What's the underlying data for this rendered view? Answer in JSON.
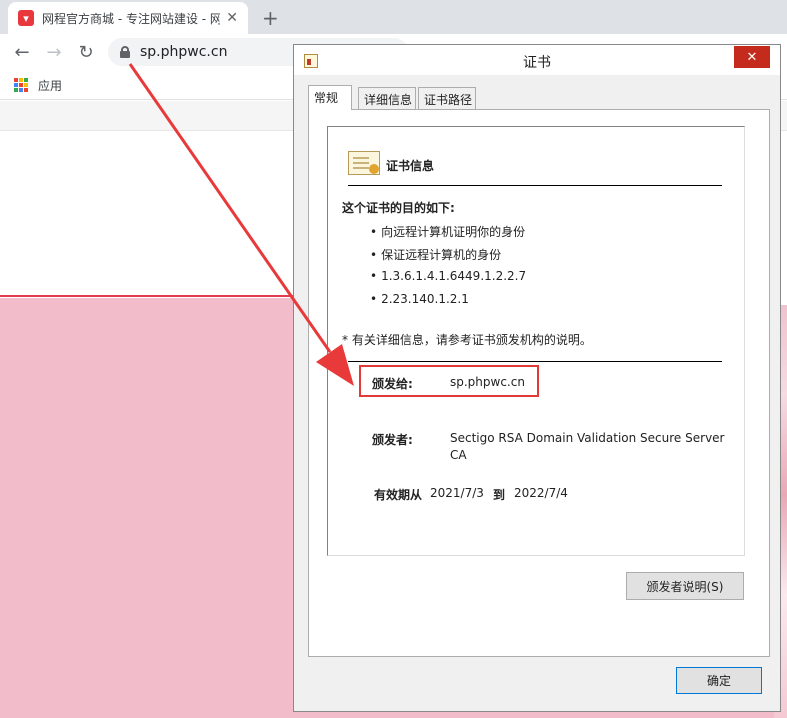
{
  "browser": {
    "tab_title": "网程官方商城 - 专注网站建设 - 网",
    "tab_close_glyph": "✕",
    "new_tab_glyph": "+",
    "back_glyph": "←",
    "forward_glyph": "→",
    "reload_glyph": "↻",
    "url": "sp.phpwc.cn",
    "bookmarks_apps_label": "应用",
    "apps_colors": [
      "#ea4335",
      "#fbbc05",
      "#34a853",
      "#4285f4",
      "#ea4335",
      "#fbbc05",
      "#34a853",
      "#4285f4",
      "#ea4335"
    ]
  },
  "dialog": {
    "title": "证书",
    "close_glyph": "✕",
    "tabs": [
      {
        "label": "常规",
        "active": true
      },
      {
        "label": "详细信息",
        "active": false
      },
      {
        "label": "证书路径",
        "active": false
      }
    ],
    "heading": "证书信息",
    "purpose_title": "这个证书的目的如下:",
    "purposes": [
      "向远程计算机证明你的身份",
      "保证远程计算机的身份",
      "1.3.6.1.4.1.6449.1.2.2.7",
      "2.23.140.1.2.1"
    ],
    "note": "* 有关详细信息，请参考证书颁发机构的说明。",
    "issued_to_label": "颁发给:",
    "issued_to_value": "sp.phpwc.cn",
    "issued_by_label": "颁发者:",
    "issued_by_value_line1": "Sectigo RSA Domain Validation Secure Server",
    "issued_by_value_line2": "CA",
    "valid_from_label": "有效期从",
    "valid_from_value": "2021/7/3",
    "valid_to_label": "到",
    "valid_to_value": "2022/7/4",
    "issuer_statement_button": "颁发者说明(S)",
    "ok_button": "确定"
  },
  "colors": {
    "highlight_red": "#e03a3a",
    "page_pink": "#f3bccb",
    "page_accent_red": "#e23b4f"
  }
}
